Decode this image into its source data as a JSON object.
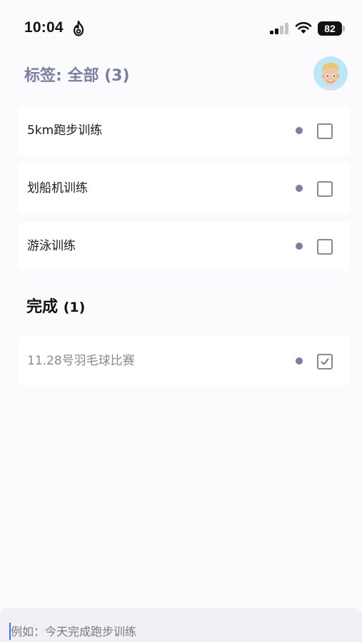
{
  "status_bar": {
    "time": "10:04",
    "battery": "82",
    "icons": [
      "flame-icon",
      "signal-icon",
      "wifi-icon",
      "battery-icon"
    ]
  },
  "header": {
    "title": "标签: 全部 (3)",
    "avatar_icon": "memoji-avatar"
  },
  "tasks": [
    {
      "label": "5km跑步训练",
      "checked": false
    },
    {
      "label": "划船机训练",
      "checked": false
    },
    {
      "label": "游泳训练",
      "checked": false
    }
  ],
  "completed": {
    "title": "完成",
    "count": "(1)",
    "items": [
      {
        "label": "11.28号羽毛球比赛",
        "checked": true
      }
    ]
  },
  "input": {
    "placeholder": "例如：今天完成跑步训练",
    "value": ""
  },
  "colors": {
    "accent": "#7b80a0",
    "background": "#fbfbfd",
    "input_bar": "#f0f0f5",
    "avatar_bg": "#bfe6f7",
    "caret": "#3b6df0"
  }
}
